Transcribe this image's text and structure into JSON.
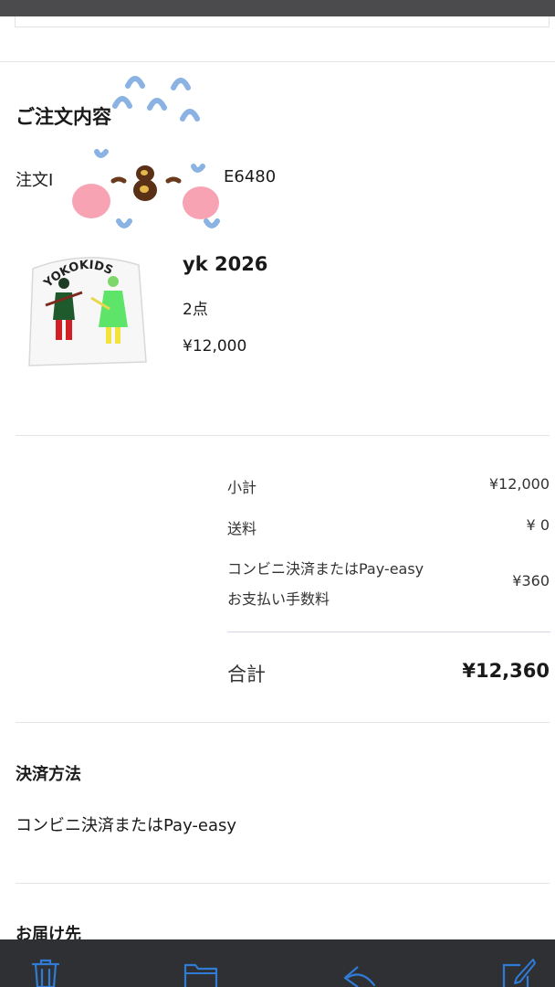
{
  "order": {
    "heading": "ご注文内容",
    "id_prefix": "注文I",
    "id_suffix": "E6480"
  },
  "product": {
    "image_text": "YOKOKIDS",
    "name": "yk 2026",
    "quantity": "2点",
    "price": "¥12,000"
  },
  "summary": {
    "subtotal_label": "小計",
    "subtotal_value": "¥12,000",
    "shipping_label": "送料",
    "shipping_value": "¥ 0",
    "fee_label_line1": "コンビニ決済またはPay-easy",
    "fee_label_line2": "お支払い手数料",
    "fee_value": "¥360",
    "total_label": "合計",
    "total_value": "¥12,360"
  },
  "payment": {
    "heading": "決済方法",
    "method": "コンビニ決済またはPay-easy"
  },
  "shipping_address": {
    "heading": "お届け先"
  },
  "toolbar": {
    "icons": [
      "trash-icon",
      "folder-icon",
      "reply-icon",
      "compose-icon"
    ],
    "accent": "#2f7bd6"
  }
}
